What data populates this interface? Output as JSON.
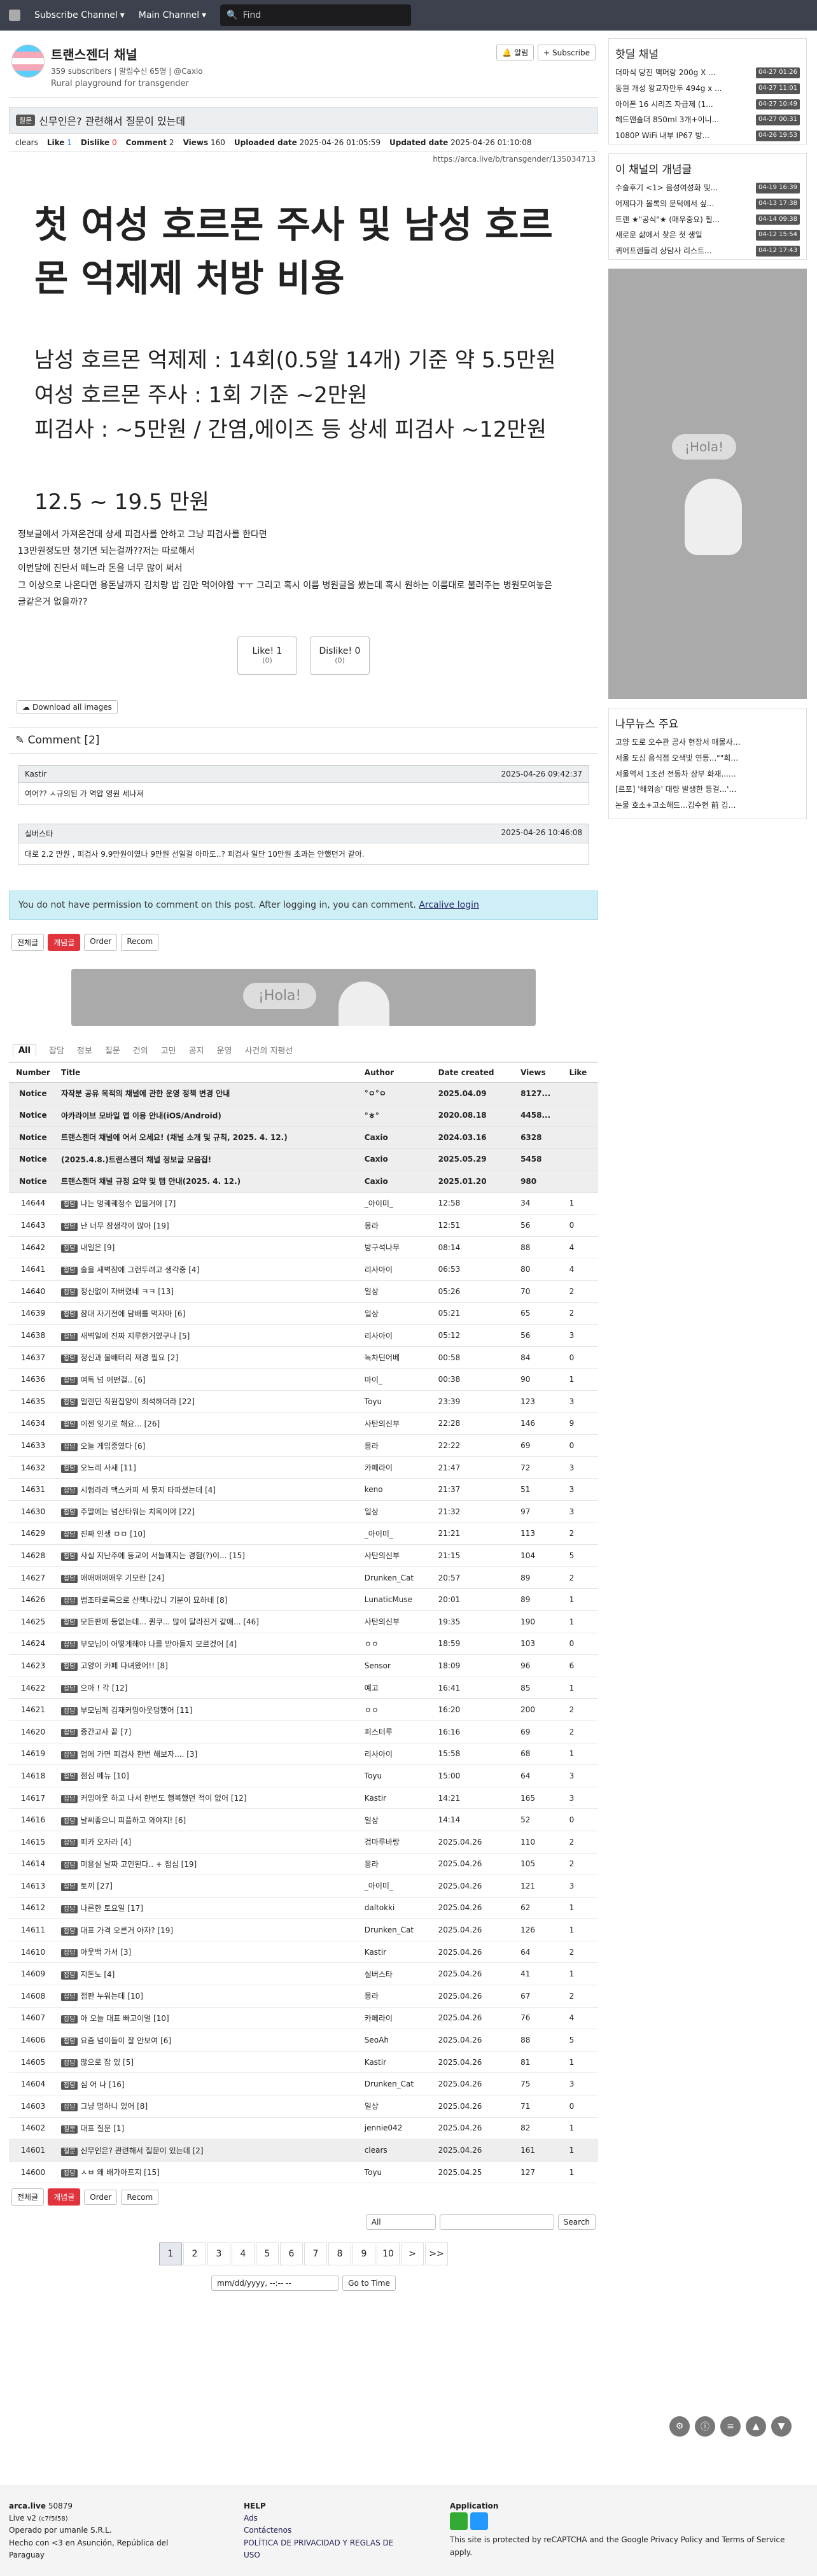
{
  "topnav": {
    "subscribe": "Subscribe Channel",
    "main": "Main Channel",
    "search_placeholder": "Find"
  },
  "board": {
    "title": "트랜스젠더 채널",
    "subscribers": "359 subscribers | 알림수신 65명 | @Caxio",
    "desc": "Rural playground for transgender",
    "alarm": "알림",
    "subscribe": "+ Subscribe"
  },
  "article": {
    "tag": "질문",
    "title": "신무인은? 관련해서 질문이 있는데",
    "author": "clears",
    "like_label": "Like",
    "like": "1",
    "dislike_label": "Dislike",
    "dislike": "0",
    "comment_label": "Comment",
    "comment": "2",
    "views_label": "Views",
    "views": "160",
    "uploaded_label": "Uploaded date",
    "uploaded": "2025-04-26 01:05:59",
    "updated_label": "Updated date",
    "updated": "2025-04-26 01:10:08",
    "link": "https://arca.live/b/transgender/135034713",
    "h1": "첫 여성 호르몬 주사 및 남성 호르몬 억제제 처방 비용",
    "lines": [
      "남성 호르몬 억제제 : 14회(0.5알 14개) 기준 약 5.5만원",
      "여성 호르몬 주사 : 1회 기준 ~2만원",
      "피검사 : ~5만원 / 간염,에이즈 등 상세 피검사 ~12만원"
    ],
    "total": "12.5 ~ 19.5 만원",
    "para": [
      "정보글에서 가져온건데 상세 피검사를 안하고 그냥 피검사를 한다면",
      "13만원정도만 챙기면 되는걸까??저는 따로해서",
      "이번달에 진단서 떼느라 돈을 너무 많이 써서",
      "그 이상으로 나온다면 용돈날까지 김치랑 밥 김만 먹어야함 ㅜㅜ 그리고 혹시 이름 병원글을 봤는데 혹시 원하는 이름대로 불러주는 병원모여놓은",
      "글같은거 없을까??"
    ],
    "vote_like": "Like!",
    "vote_like_n": "1",
    "vote_like_sub": "(0)",
    "vote_dislike": "Dislike!",
    "vote_dislike_n": "0",
    "vote_dislike_sub": "(0)",
    "download": "Download all images"
  },
  "comments": {
    "header": "Comment [2]",
    "items": [
      {
        "author": "Kastir",
        "date": "2025-04-26 09:42:37",
        "text": "여어?? ㅅ규의된 가 역압 영원 세나져"
      },
      {
        "author": "실버스타",
        "date": "2025-04-26 10:46:08",
        "text": "대로 2.2 만원 , 피검사 9.9만원이였나 9만원 선일걸 아마도..? 피검사 일단 10만원 초과는 안했던거 같아."
      }
    ]
  },
  "permission": {
    "text": "You do not have permission to comment on this post. After logging in, you can comment.",
    "link": "Arcalive login"
  },
  "toolbar": {
    "all": "전체글",
    "best": "개념글",
    "order": "Order",
    "recom": "Recom"
  },
  "ad_text": "¡Hola!",
  "categories": [
    "All",
    "잡담",
    "정보",
    "질문",
    "건의",
    "고민",
    "공지",
    "운영",
    "사건의 지평선"
  ],
  "table": {
    "headers": [
      "Number",
      "Title",
      "Author",
      "Date created",
      "Views",
      "Like"
    ],
    "notices": [
      {
        "num": "Notice",
        "title": "자작분 공유 목적의 채널에 관한 운영 정책 변경 안내",
        "author": "°ㅇ°ㅇ",
        "date": "2025.04.09",
        "views": "8127...",
        "like": ""
      },
      {
        "num": "Notice",
        "title": "아카라이브 모바일 앱 이용 안내(iOS/Android)",
        "author": "°ㅎ°",
        "date": "2020.08.18",
        "views": "4458...",
        "like": ""
      },
      {
        "num": "Notice",
        "title": "트랜스젠더 채널에 어서 오세요! (채널 소개 및 규칙, 2025. 4. 12.)",
        "author": "Caxio",
        "date": "2024.03.16",
        "views": "6328",
        "like": ""
      },
      {
        "num": "Notice",
        "title": "(2025.4.8.)트랜스젠더 채널 정보글 모음집!",
        "author": "Caxio",
        "date": "2025.05.29",
        "views": "5458",
        "like": ""
      },
      {
        "num": "Notice",
        "title": "트랜스젠더 채널 규정 요약 및 탭 안내(2025. 4. 12.)",
        "author": "Caxio",
        "date": "2025.01.20",
        "views": "980",
        "like": ""
      }
    ],
    "rows": [
      {
        "num": "14644",
        "tag": "잡담",
        "title": "나는 멍퀘퀘정수 입을거야 [7]",
        "author": "_아이미_",
        "date": "12:58",
        "views": "34",
        "like": "1"
      },
      {
        "num": "14643",
        "tag": "잡담",
        "title": "난 너무 잠생각이 많아 [19]",
        "author": "몽라",
        "date": "12:51",
        "views": "56",
        "like": "0"
      },
      {
        "num": "14642",
        "tag": "잡담",
        "title": "내일은 [9]",
        "author": "방구석나무",
        "date": "08:14",
        "views": "88",
        "like": "4"
      },
      {
        "num": "14641",
        "tag": "잡담",
        "title": "술을 새벽잠에 그런두려고 생각중 [4]",
        "author": "리사아이",
        "date": "06:53",
        "views": "80",
        "like": "4"
      },
      {
        "num": "14640",
        "tag": "잡담",
        "title": "정신없이 자버렸네 ㅋㅋ [13]",
        "author": "일상",
        "date": "05:26",
        "views": "70",
        "like": "2"
      },
      {
        "num": "14639",
        "tag": "잡담",
        "title": "잠대 자기전에 담배를 먹자마 [6]",
        "author": "일상",
        "date": "05:21",
        "views": "65",
        "like": "2"
      },
      {
        "num": "14638",
        "tag": "잡담",
        "title": "새벽일에 진짜 지루한거였구나 [5]",
        "author": "리사아이",
        "date": "05:12",
        "views": "56",
        "like": "3"
      },
      {
        "num": "14637",
        "tag": "잡담",
        "title": "정신과 물배터리 재경 필요 [2]",
        "author": "녹차딘어베",
        "date": "00:58",
        "views": "84",
        "like": "0"
      },
      {
        "num": "14636",
        "tag": "잡담",
        "title": "여독 넘 어떤걸.. [6]",
        "author": "마이_",
        "date": "00:38",
        "views": "90",
        "like": "1"
      },
      {
        "num": "14635",
        "tag": "잡담",
        "title": "일렌던 직원집양이 최석하더라 [22]",
        "author": "Toyu",
        "date": "23:39",
        "views": "123",
        "like": "3"
      },
      {
        "num": "14634",
        "tag": "잡담",
        "title": "이젠 잊기로 해요... [26]",
        "author": "사탄의신부",
        "date": "22:28",
        "views": "146",
        "like": "9"
      },
      {
        "num": "14633",
        "tag": "잡담",
        "title": "오늘 게임중였다 [6]",
        "author": "몽라",
        "date": "22:22",
        "views": "69",
        "like": "0"
      },
      {
        "num": "14632",
        "tag": "잡담",
        "title": "오느레 사새 [11]",
        "author": "카페라이",
        "date": "21:47",
        "views": "72",
        "like": "3"
      },
      {
        "num": "14631",
        "tag": "잡담",
        "title": "시험라라 맥스커피 세 묶지 타파셨는데 [4]",
        "author": "keno",
        "date": "21:37",
        "views": "51",
        "like": "3"
      },
      {
        "num": "14630",
        "tag": "잡담",
        "title": "주말에는 넘산타워는 치옥이야 [22]",
        "author": "일상",
        "date": "21:32",
        "views": "97",
        "like": "3"
      },
      {
        "num": "14629",
        "tag": "잡담",
        "title": "진짜 인생 ㅁㅁ [10]",
        "author": "_아이미_",
        "date": "21:21",
        "views": "113",
        "like": "2"
      },
      {
        "num": "14628",
        "tag": "잡담",
        "title": "사실 지난주에 등교이 서늘꽤지는 경험(?)이... [15]",
        "author": "사탄의신부",
        "date": "21:15",
        "views": "104",
        "like": "5"
      },
      {
        "num": "14627",
        "tag": "잡담",
        "title": "애애애애애우 기모란 [24]",
        "author": "Drunken_Cat",
        "date": "20:57",
        "views": "89",
        "like": "2"
      },
      {
        "num": "14626",
        "tag": "잡담",
        "title": "범조타로록으로 산책나갔니 기분이 묘하네 [8]",
        "author": "LunaticMuse",
        "date": "20:01",
        "views": "89",
        "like": "1"
      },
      {
        "num": "14625",
        "tag": "잡담",
        "title": "모든판에 등없는데... 퀀쿠... 많이 달라진거 같애... [46]",
        "author": "사탄의신부",
        "date": "19:35",
        "views": "190",
        "like": "1"
      },
      {
        "num": "14624",
        "tag": "잡담",
        "title": "부모님이 어떻게해야 나를 받아들지 모르겠어 [4]",
        "author": "ㅇㅇ",
        "date": "18:59",
        "views": "103",
        "like": "0"
      },
      {
        "num": "14623",
        "tag": "잡담",
        "title": "고양이 카페 다녀왔어!! [8]",
        "author": "Sensor",
        "date": "18:09",
        "views": "96",
        "like": "6"
      },
      {
        "num": "14622",
        "tag": "잡담",
        "title": "으아 ! 각 [12]",
        "author": "예고",
        "date": "16:41",
        "views": "85",
        "like": "1"
      },
      {
        "num": "14621",
        "tag": "잡담",
        "title": "부모님께 김재커밍아웃덩했어 [11]",
        "author": "ㅇㅇ",
        "date": "16:20",
        "views": "200",
        "like": "2"
      },
      {
        "num": "14620",
        "tag": "잡담",
        "title": "중간고사 끝 [7]",
        "author": "피스터루",
        "date": "16:16",
        "views": "69",
        "like": "2"
      },
      {
        "num": "14619",
        "tag": "잡담",
        "title": "엄에 가면 피검사 한번 해보자.... [3]",
        "author": "리사아이",
        "date": "15:58",
        "views": "68",
        "like": "1"
      },
      {
        "num": "14618",
        "tag": "잡담",
        "title": "점심 메뉴 [10]",
        "author": "Toyu",
        "date": "15:00",
        "views": "64",
        "like": "3"
      },
      {
        "num": "14617",
        "tag": "잡담",
        "title": "커밍아웃 하고 나서 한번도 행복했던 적이 없어 [12]",
        "author": "Kastir",
        "date": "14:21",
        "views": "165",
        "like": "3"
      },
      {
        "num": "14616",
        "tag": "잡담",
        "title": "날씨좋으니 피플하고 와야지! [6]",
        "author": "일상",
        "date": "14:14",
        "views": "52",
        "like": "0"
      },
      {
        "num": "14615",
        "tag": "잡담",
        "title": "피카 오자라 [4]",
        "author": "검마루바랑",
        "date": "2025.04.26",
        "views": "110",
        "like": "2"
      },
      {
        "num": "14614",
        "tag": "잡담",
        "title": "미용실 날짜 고민된다.. + 점심 [19]",
        "author": "몽라",
        "date": "2025.04.26",
        "views": "105",
        "like": "2"
      },
      {
        "num": "14613",
        "tag": "잡담",
        "title": "토끼 [27]",
        "author": "_아이미_",
        "date": "2025.04.26",
        "views": "121",
        "like": "3"
      },
      {
        "num": "14612",
        "tag": "잡담",
        "title": "나른한 토요일 [17]",
        "author": "daltokki",
        "date": "2025.04.26",
        "views": "62",
        "like": "1"
      },
      {
        "num": "14611",
        "tag": "잡담",
        "title": "대표 가격 오른거 아자? [19]",
        "author": "Drunken_Cat",
        "date": "2025.04.26",
        "views": "126",
        "like": "1"
      },
      {
        "num": "14610",
        "tag": "잡담",
        "title": "아웃백 가서 [3]",
        "author": "Kastir",
        "date": "2025.04.26",
        "views": "64",
        "like": "2"
      },
      {
        "num": "14609",
        "tag": "잡담",
        "title": "지돈노 [4]",
        "author": "실버스타",
        "date": "2025.04.26",
        "views": "41",
        "like": "1"
      },
      {
        "num": "14608",
        "tag": "잡담",
        "title": "점판 누워는데 [10]",
        "author": "몽라",
        "date": "2025.04.26",
        "views": "67",
        "like": "2"
      },
      {
        "num": "14607",
        "tag": "잡담",
        "title": "아 오늘 대표 빠고이얼 [10]",
        "author": "카페라이",
        "date": "2025.04.26",
        "views": "76",
        "like": "4"
      },
      {
        "num": "14606",
        "tag": "잡담",
        "title": "요즘 넘이들이 잘 안보여 [6]",
        "author": "SeoAh",
        "date": "2025.04.26",
        "views": "88",
        "like": "5"
      },
      {
        "num": "14605",
        "tag": "잡담",
        "title": "많으로 잠 있 [5]",
        "author": "Kastir",
        "date": "2025.04.26",
        "views": "81",
        "like": "1"
      },
      {
        "num": "14604",
        "tag": "잡담",
        "title": "심 어 나 [16]",
        "author": "Drunken_Cat",
        "date": "2025.04.26",
        "views": "75",
        "like": "3"
      },
      {
        "num": "14603",
        "tag": "잡담",
        "title": "그냥 멍하니 있어 [8]",
        "author": "일상",
        "date": "2025.04.26",
        "views": "71",
        "like": "0"
      },
      {
        "num": "14602",
        "tag": "질문",
        "title": "대표 질문 [1]",
        "author": "jennie042",
        "date": "2025.04.26",
        "views": "82",
        "like": "1"
      },
      {
        "num": "14601",
        "tag": "질문",
        "title": "신무인은? 관련해서 질문이 있는데 [2]",
        "author": "clears",
        "date": "2025.04.26",
        "views": "161",
        "like": "1",
        "cur": true
      },
      {
        "num": "14600",
        "tag": "잡담",
        "title": "ㅅㅂ 왜 배가아프지 [15]",
        "author": "Toyu",
        "date": "2025.04.25",
        "views": "127",
        "like": "1"
      }
    ]
  },
  "search": {
    "scope": "All",
    "button": "Search"
  },
  "pages": [
    "1",
    "2",
    "3",
    "4",
    "5",
    "6",
    "7",
    "8",
    "9",
    "10"
  ],
  "date_input": {
    "placeholder": "mm/dd/yyyy, --:-- --",
    "button": "Go to Time"
  },
  "side": {
    "hot": {
      "title": "핫딜 채널",
      "items": [
        {
          "t": "더마식 당진 맥머랑 200g X ...",
          "time": "04-27 01:26"
        },
        {
          "t": "동원 개성 왕교자만두 494g x ...",
          "time": "04-27 11:01"
        },
        {
          "t": "아이폰 16 시리즈 자급제 (1...",
          "time": "04-27 10:49"
        },
        {
          "t": "헤드앤숄더 850ml 3개+이니...",
          "time": "04-27 00:31"
        },
        {
          "t": "1080P WiFi 내부 IP67 방...",
          "time": "04-26 19:53"
        }
      ]
    },
    "best": {
      "title": "이 채널의 개념글",
      "items": [
        {
          "t": "수술후기 <1> 음성여성화 및...",
          "time": "04-19 16:39"
        },
        {
          "t": "어제다가 볼록의 문턱에서 싶...",
          "time": "04-13 17:38"
        },
        {
          "t": "트랜 ★\"공식\"★ (매우중요) 필...",
          "time": "04-14 09:38"
        },
        {
          "t": "새로운 삶에서 찾은 첫 생일",
          "time": "04-12 15:54"
        },
        {
          "t": "퀴어프렌들리 상담사 리스트...",
          "time": "04-12 17:43"
        }
      ]
    },
    "news": {
      "title": "나무뉴스 주요",
      "items": [
        {
          "t": "고양 도로 오수관 공사 현장서 매몰사고로 2..."
        },
        {
          "t": "서울 도심 음식점 오색빛 연등...\"\"희망의 등..."
        },
        {
          "t": "서울역서 1조선 전동차 상부 화재...인명피해..."
        },
        {
          "t": "[르포] '해외송' 대량 발생한 등걸...'유전운..."
        },
        {
          "t": "논물 호소+고소해드...김수현 前 김새론 사..."
        }
      ]
    }
  },
  "footer": {
    "brand": "arca.live",
    "count": "50879",
    "ver": "Live v2",
    "ver_sub": "(c7f5f58)",
    "op": "Operado por umanle S.R.L.",
    "made": "Hecho con <3 en Asunción, República del Paraguay",
    "help": "HELP",
    "help_links": [
      "Ads",
      "Contáctenos",
      "POLÍTICA DE PRIVACIDAD Y REGLAS DE USO"
    ],
    "app": "Application",
    "recaptcha": "This site is protected by reCAPTCHA and the Google Privacy Policy and Terms of Service apply."
  }
}
